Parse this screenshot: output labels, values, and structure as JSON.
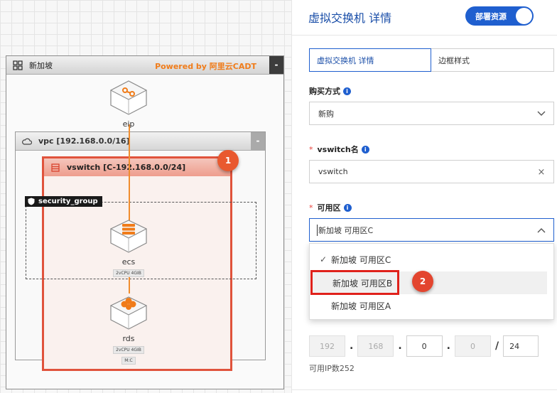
{
  "canvas": {
    "region": {
      "title": "新加坡",
      "powered_by": "Powered by 阿里云CADT",
      "collapse": "-"
    },
    "vpc": {
      "title": "vpc [192.168.0.0/16]",
      "collapse": "-"
    },
    "vswitch": {
      "title": "vswitch [C-192.168.0.0/24]",
      "step": "1"
    },
    "security_group": {
      "label": "security_group"
    },
    "nodes": {
      "eip": {
        "label": "eip"
      },
      "ecs": {
        "label": "ecs",
        "tags": [
          "2vCPU 4GIB"
        ]
      },
      "rds": {
        "label": "rds",
        "tags": [
          "2vCPU 4GIB",
          "M:C"
        ]
      }
    },
    "colors": {
      "accent": "#f07c1a",
      "vswitch_border": "#e0533c",
      "step_badge": "#e9592f"
    }
  },
  "panel": {
    "title": "虚拟交换机 详情",
    "deploy_toggle": {
      "label": "部署资源",
      "on": true
    },
    "tabs": [
      {
        "label": "虚拟交换机 详情",
        "active": true
      },
      {
        "label": "边框样式",
        "active": false
      }
    ],
    "purchase": {
      "label": "购买方式",
      "value": "新购"
    },
    "vswitch_name": {
      "label": "vswitch名",
      "value": "vswitch",
      "clear": "×"
    },
    "zone": {
      "label": "可用区",
      "value": "新加坡 可用区C",
      "options": [
        {
          "label": "新加坡 可用区C",
          "selected": true
        },
        {
          "label": "新加坡 可用区B",
          "selected": false,
          "hovered": true
        },
        {
          "label": "新加坡 可用区A",
          "selected": false
        }
      ],
      "step": "2"
    },
    "ip": {
      "octets": [
        "192",
        "168",
        "0",
        "0"
      ],
      "mask": "24",
      "dot": ".",
      "slash": "/",
      "available": "可用IP数252"
    },
    "colors": {
      "primary": "#1f5fcf",
      "highlight": "#e0211b"
    }
  }
}
